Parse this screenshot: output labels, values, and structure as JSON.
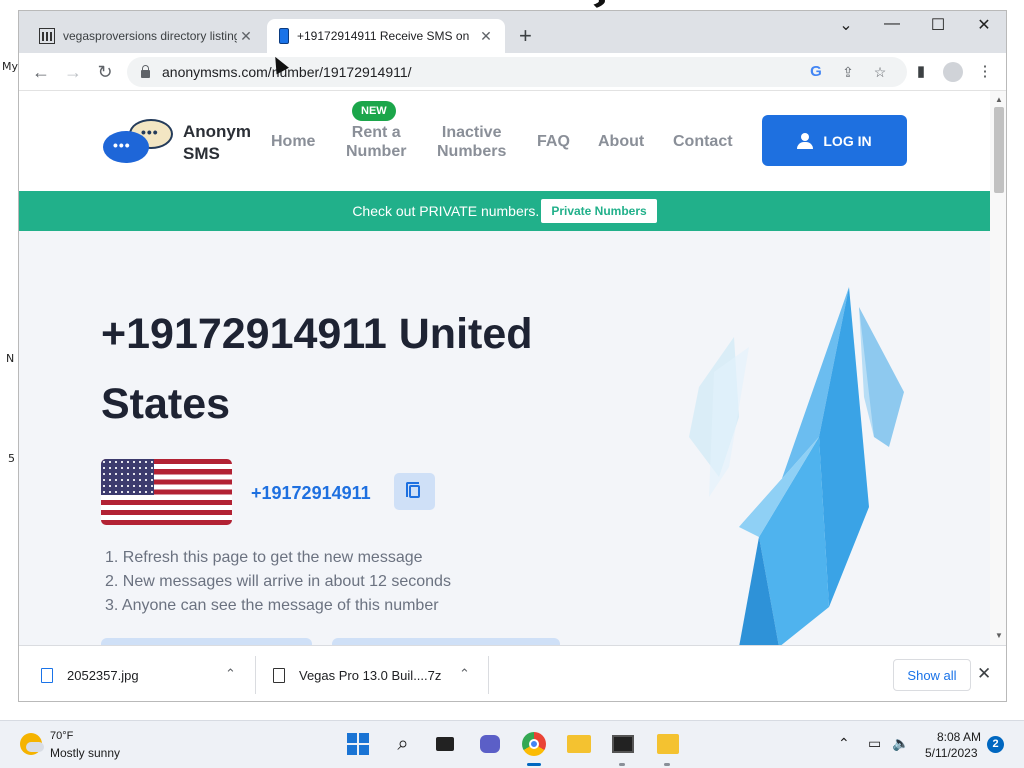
{
  "browser": {
    "tabs": [
      {
        "title": "vegasproversions directory listing",
        "icon": "bank-icon"
      },
      {
        "title": "+19172914911 Receive SMS on",
        "icon": "phone-icon"
      }
    ],
    "url": "anonymsms.com/number/19172914911/"
  },
  "site": {
    "logo_text_line1": "Anonym",
    "logo_text_line2": "SMS",
    "nav": {
      "home": "Home",
      "rent_line1": "Rent a",
      "rent_line2": "Number",
      "new_badge": "NEW",
      "inactive_line1": "Inactive",
      "inactive_line2": "Numbers",
      "faq": "FAQ",
      "about": "About",
      "contact": "Contact",
      "login": "LOG IN"
    },
    "promo": {
      "text": "Check out PRIVATE numbers.",
      "button": "Private Numbers"
    },
    "hero": {
      "title": "+19172914911 United States",
      "number": "+19172914911",
      "instructions": [
        "1. Refresh this page to get the new message",
        "2. New messages will arrive in about 12 seconds",
        "3. Anyone can see the message of this number"
      ]
    },
    "colors": {
      "primary": "#1e70e0",
      "promo": "#21b08a",
      "badge": "#1ba64a",
      "title": "#1e2333"
    }
  },
  "downloads": {
    "items": [
      {
        "name": "2052357.jpg"
      },
      {
        "name": "Vegas Pro 13.0 Buil....7z"
      }
    ],
    "show_all": "Show all"
  },
  "taskbar": {
    "temperature": "70°F",
    "weather": "Mostly sunny",
    "time": "8:08 AM",
    "date": "5/11/2023",
    "notifications": "2"
  }
}
